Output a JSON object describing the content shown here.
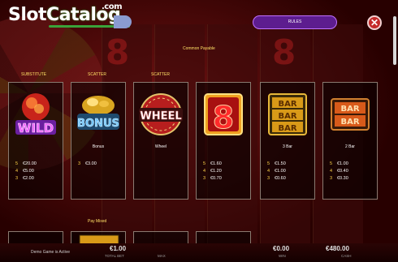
{
  "header": {
    "logo_slot": "Slot",
    "logo_catalog": "Catalog",
    "logo_com": ".com",
    "rules_tab": "RULES",
    "close_symbol": "✕"
  },
  "paytable": {
    "common_payable": "Common Payable",
    "pay_mixed": "Pay Mixed",
    "cards": [
      {
        "section": "SUBSTITUTE",
        "symbol_text": "WILD",
        "name": "",
        "pays": [
          {
            "n": "5",
            "v": "€20.00"
          },
          {
            "n": "4",
            "v": "€5.00"
          },
          {
            "n": "3",
            "v": "€2.00"
          }
        ]
      },
      {
        "section": "SCATTER",
        "symbol_text": "BONUS",
        "name": "Bonus",
        "pays": [
          {
            "n": "3",
            "v": "€3.00"
          }
        ]
      },
      {
        "section": "SCATTER",
        "symbol_text": "WHEEL",
        "name": "Wheel",
        "pays": []
      },
      {
        "section": "",
        "symbol_text": "8",
        "name": "",
        "pays": [
          {
            "n": "5",
            "v": "€1.60"
          },
          {
            "n": "4",
            "v": "€1.20"
          },
          {
            "n": "3",
            "v": "€0.70"
          }
        ]
      },
      {
        "section": "",
        "symbol_text": "BAR",
        "name": "3 Bar",
        "pays": [
          {
            "n": "5",
            "v": "€1.50"
          },
          {
            "n": "4",
            "v": "€1.00"
          },
          {
            "n": "3",
            "v": "€0.60"
          }
        ]
      },
      {
        "section": "",
        "symbol_text": "BAR",
        "name": "2 Bar",
        "pays": [
          {
            "n": "5",
            "v": "€1.00"
          },
          {
            "n": "4",
            "v": "€0.40"
          },
          {
            "n": "3",
            "v": "€0.30"
          }
        ]
      }
    ]
  },
  "footer": {
    "demo_text": "Demo Game is Active",
    "total_bet_amount": "€1.00",
    "total_bet_label": "TOTAL BET",
    "max_label": "MAX",
    "win_amount": "€0.00",
    "win_label": "WIN",
    "cash_amount": "€480.00",
    "cash_label": "CASH"
  },
  "colors": {
    "accent_gold": "#ffd54a",
    "rules_purple": "#5d1d8f",
    "close_red": "#c52a2a"
  }
}
